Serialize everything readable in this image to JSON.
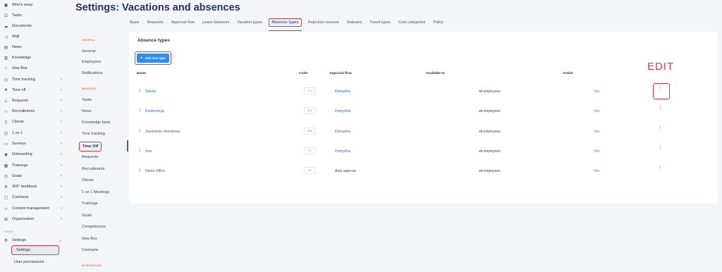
{
  "page": {
    "title": "Settings: Vacations and absences"
  },
  "sidebar": {
    "items": [
      {
        "label": "Who's away",
        "icon": "calendar-user-icon",
        "chevron": false
      },
      {
        "label": "Tasks",
        "icon": "checkbox-icon",
        "chevron": false
      },
      {
        "label": "Documents",
        "icon": "cloud-icon",
        "chevron": false
      },
      {
        "label": "Wall",
        "icon": "megaphone-icon",
        "chevron": false
      },
      {
        "label": "News",
        "icon": "newspaper-icon",
        "chevron": false
      },
      {
        "label": "Knowledge",
        "icon": "book-icon",
        "chevron": false
      },
      {
        "label": "Idea Box",
        "icon": "lightbulb-icon",
        "chevron": false
      },
      {
        "label": "Time tracking",
        "icon": "stopwatch-icon",
        "chevron": true
      },
      {
        "label": "Time off",
        "icon": "palm-icon",
        "chevron": true
      },
      {
        "label": "Requests",
        "icon": "inbox-icon",
        "chevron": true
      },
      {
        "label": "Recruitments",
        "icon": "star-icon",
        "chevron": true
      },
      {
        "label": "Clients",
        "icon": "clipboard-icon",
        "chevron": true
      },
      {
        "label": "1 on 1",
        "icon": "chat-icon",
        "chevron": true
      },
      {
        "label": "Surveys",
        "icon": "survey-icon",
        "chevron": true
      },
      {
        "label": "Onboarding",
        "icon": "location-icon",
        "chevron": true
      },
      {
        "label": "Trainings",
        "icon": "training-icon",
        "chevron": true
      },
      {
        "label": "Goals",
        "icon": "target-icon",
        "chevron": true
      },
      {
        "label": "360° feedback",
        "icon": "feedback-icon",
        "chevron": true
      },
      {
        "label": "Contracts",
        "icon": "contract-icon",
        "chevron": true
      },
      {
        "label": "Content management",
        "icon": "content-icon",
        "chevron": true
      },
      {
        "label": "Organization",
        "icon": "org-chart-icon",
        "chevron": true
      }
    ],
    "admin_section": "ADMIN",
    "settings": {
      "label": "Settings",
      "icon": "gear-icon",
      "chevron": "⌄"
    },
    "settings_sub": [
      {
        "label": "Settings",
        "active": true
      },
      {
        "label": "User permissions",
        "active": false
      }
    ]
  },
  "tabs": [
    {
      "label": "Basic",
      "active": false
    },
    {
      "label": "Requests",
      "active": false
    },
    {
      "label": "Approval flow",
      "active": false
    },
    {
      "label": "Leave balances",
      "active": false
    },
    {
      "label": "Vacation types",
      "active": false
    },
    {
      "label": "Absence types",
      "active": true
    },
    {
      "label": "Rejection reasons",
      "active": false
    },
    {
      "label": "Statuses",
      "active": false
    },
    {
      "label": "Travel types",
      "active": false
    },
    {
      "label": "Cost categories",
      "active": false
    },
    {
      "label": "Policy",
      "active": false
    }
  ],
  "subnav": {
    "general_section": "GENERAL",
    "general": [
      "General",
      "Employees",
      "Notifications"
    ],
    "modules_section": "MODULES",
    "modules": [
      "Tasks",
      "News",
      "Knowledge base",
      "Time tracking",
      "Time Off",
      "Requests",
      "Recruitments",
      "Clients",
      "1 on 1 Meetings",
      "Trainings",
      "Goals",
      "Competences",
      "Idea Box",
      "Contracts"
    ],
    "active": "Time Off",
    "integration_section": "INTEGRATION"
  },
  "card": {
    "title": "Absence types",
    "add_button": "Add new type",
    "columns": {
      "name": "Name",
      "code": "Code",
      "approval_flow": "Approval flow",
      "available_to": "Available to",
      "active": "Active"
    },
    "rows": [
      {
        "name": "Szkola",
        "code": "SZK",
        "code_color": "#e8a93a",
        "approval_flow": "Domyślna",
        "flow_link": true,
        "available_to": "all employees",
        "active": "Yes"
      },
      {
        "name": "Konferencja",
        "code": "CNF",
        "code_color": "#b06ad6",
        "approval_flow": "Domyślna",
        "flow_link": true,
        "available_to": "all employees",
        "active": "Yes"
      },
      {
        "name": "Zwolnienie chorobowe",
        "code": "SKK",
        "code_color": "#6a80d6",
        "approval_flow": "Domyślna",
        "flow_link": true,
        "available_to": "all employees",
        "active": "Yes"
      },
      {
        "name": "Inne",
        "code": "OTL",
        "code_color": "#999999",
        "approval_flow": "Domyślna",
        "flow_link": true,
        "available_to": "all employees",
        "active": "Yes"
      },
      {
        "name": "Home Office",
        "code": "HO",
        "code_color": "#999999",
        "approval_flow": "Auto-approve",
        "flow_link": false,
        "available_to": "all employees",
        "active": "Yes"
      }
    ]
  },
  "annotation": {
    "edit_label": "EDIT"
  }
}
